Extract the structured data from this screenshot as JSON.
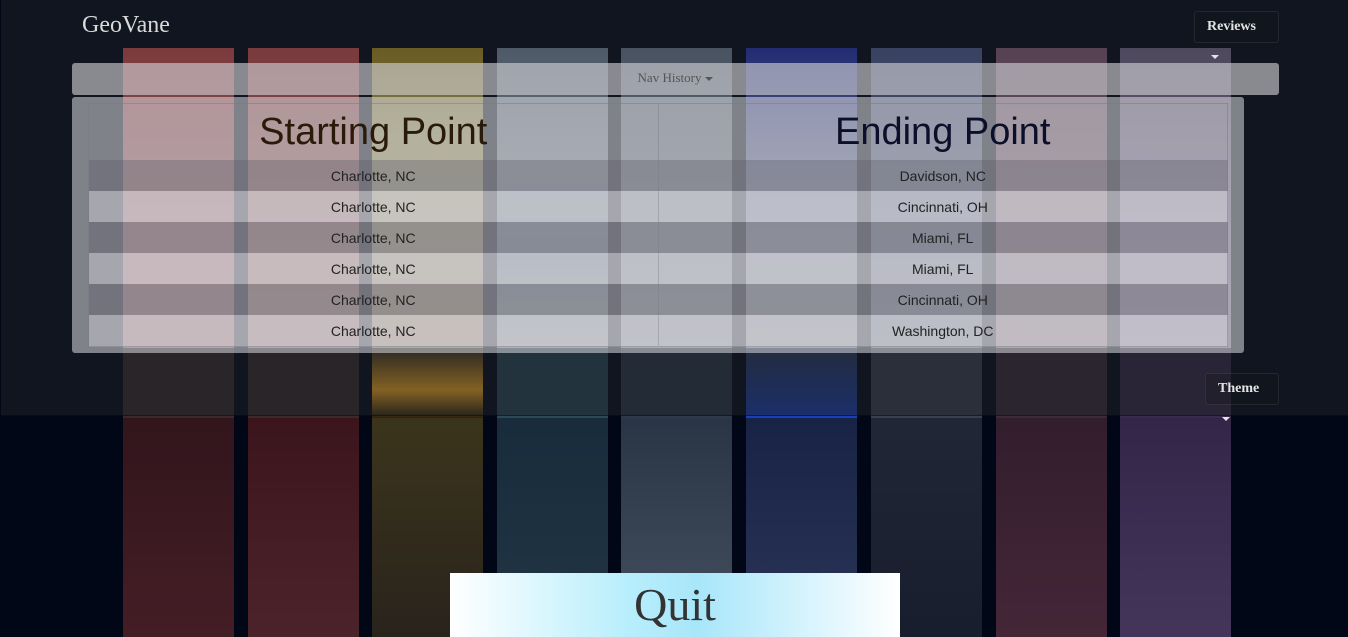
{
  "navbar": {
    "brand": "GeoVane",
    "reviews_label": "Reviews",
    "nav_history_label": "Nav History",
    "theme_label": "Theme"
  },
  "history_table": {
    "headers": [
      "Starting Point",
      "Ending Point"
    ],
    "rows": [
      {
        "start": "Charlotte, NC",
        "end": "Davidson, NC"
      },
      {
        "start": "Charlotte, NC",
        "end": "Cincinnati, OH"
      },
      {
        "start": "Charlotte, NC",
        "end": "Miami, FL"
      },
      {
        "start": "Charlotte, NC",
        "end": "Miami, FL"
      },
      {
        "start": "Charlotte, NC",
        "end": "Cincinnati, OH"
      },
      {
        "start": "Charlotte, NC",
        "end": "Washington, DC"
      }
    ]
  },
  "quit_label": "Quit",
  "colors": {
    "quit_gradient_center": "#a8e6fa",
    "background": "#020718"
  }
}
